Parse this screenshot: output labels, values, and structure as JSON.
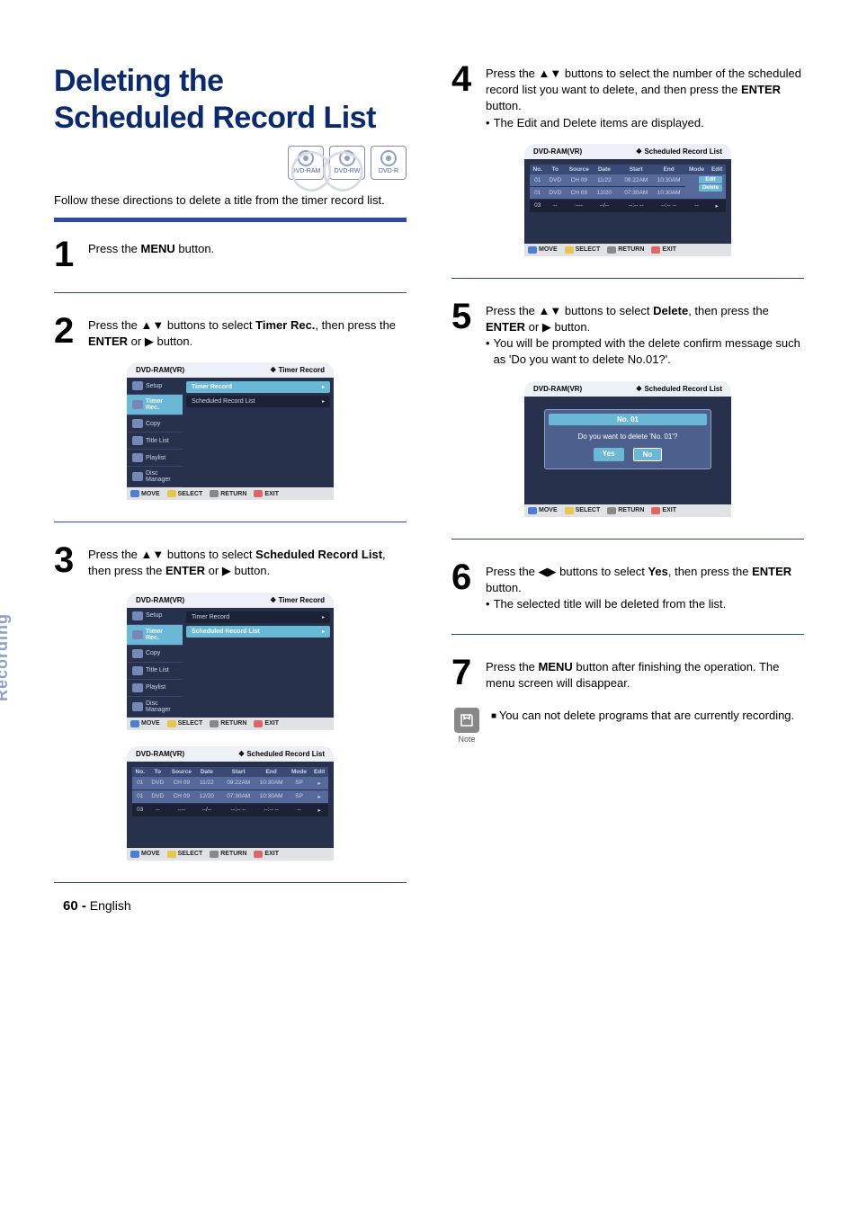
{
  "title_line1": "Deleting the",
  "title_line2": "Scheduled Record List",
  "discs": [
    "DVD-RAM",
    "DVD-RW",
    "DVD-R"
  ],
  "intro": "Follow these directions to delete a title from the timer record list.",
  "steps": {
    "s1": {
      "text_pre": "Press the ",
      "text_bold": "MENU",
      "text_post": " button."
    },
    "s2": {
      "text_a": "Press the ",
      "text_b": " buttons to select ",
      "text_bold1": "Timer Rec.",
      "text_c": ", then press the ",
      "text_bold2": "ENTER",
      "text_d": " or ",
      "text_e": " button."
    },
    "s3": {
      "text_a": "Press the ",
      "text_b": " buttons to select ",
      "text_bold1": "Scheduled Record List",
      "text_c": ", then press the ",
      "text_bold2": "ENTER",
      "text_d": " or ",
      "text_e": " button."
    },
    "s4": {
      "text_a": "Press the ",
      "text_b": " buttons to select the number of the scheduled record list you want to delete, and then press the ",
      "text_bold": "ENTER",
      "text_c": " button.",
      "bullet": "The Edit and Delete items are displayed."
    },
    "s5": {
      "text_a": "Press the ",
      "text_b": " buttons to select ",
      "text_bold1": "Delete",
      "text_c": ", then press the ",
      "text_bold2": "ENTER",
      "text_d": " or ",
      "text_e": " button.",
      "bullet": "You will be prompted with the delete confirm message such as 'Do you want to delete No.01?'."
    },
    "s6": {
      "text_a": "Press the ",
      "text_b": " buttons to select ",
      "text_bold1": "Yes",
      "text_c": ", then press the ",
      "text_bold2": "ENTER",
      "text_d": " button.",
      "bullet": "The selected title will be deleted from the list."
    },
    "s7": {
      "text_a": "Press the ",
      "text_bold": "MENU",
      "text_b": " button after finishing the operation. The menu screen will disappear."
    }
  },
  "osd": {
    "device": "DVD-RAM(VR)",
    "title_timer": "Timer Record",
    "title_sched": "Scheduled Record List",
    "side": [
      "Setup",
      "Timer Rec.",
      "Copy",
      "Title List",
      "Playlist",
      "Disc Manager"
    ],
    "main": [
      "Timer Record",
      "Scheduled Record List"
    ],
    "foot": {
      "move": "MOVE",
      "select": "SELECT",
      "return": "RETURN",
      "exit": "EXIT"
    },
    "cols": [
      "No.",
      "To",
      "Source",
      "Date",
      "Start",
      "End",
      "Mode",
      "Edit"
    ],
    "rows": [
      {
        "no": "01",
        "to": "DVD",
        "src": "CH 09",
        "date": "11/22",
        "start": "09:22AM",
        "end": "10:30AM",
        "mode": "SP"
      },
      {
        "no": "01",
        "to": "DVD",
        "src": "CH 09",
        "date": "12/20",
        "start": "07:30AM",
        "end": "10:30AM",
        "mode": "SP"
      },
      {
        "no": "03",
        "to": "--",
        "src": "----",
        "date": "--/--",
        "start": "--:-- --",
        "end": "--:-- --",
        "mode": "--"
      }
    ],
    "edit_menu": [
      "Edit",
      "Delete"
    ],
    "dialog": {
      "title": "No. 01",
      "msg": "Do you want to delete 'No. 01'?",
      "yes": "Yes",
      "no": "No"
    }
  },
  "sidebar": "Recording",
  "note_label": "Note",
  "note_text": "You can not delete programs that are currently recording.",
  "footer_page": "60 -",
  "footer_lang": "English"
}
